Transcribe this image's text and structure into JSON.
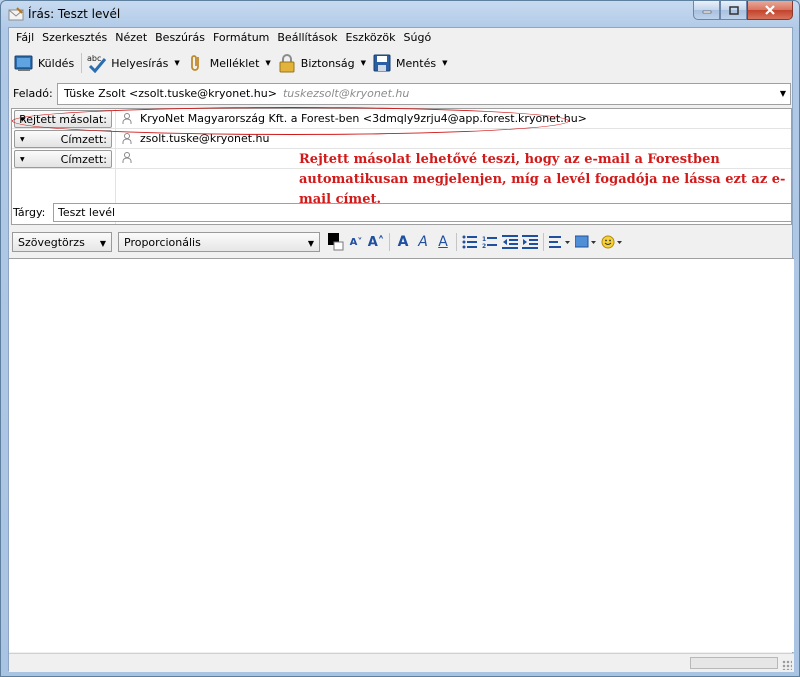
{
  "window": {
    "title": "Írás: Teszt levél"
  },
  "menu": [
    {
      "label": "Fájl"
    },
    {
      "label": "Szerkesztés"
    },
    {
      "label": "Nézet"
    },
    {
      "label": "Beszúrás"
    },
    {
      "label": "Formátum"
    },
    {
      "label": "Beállítások"
    },
    {
      "label": "Eszközök"
    },
    {
      "label": "Súgó"
    }
  ],
  "toolbar": {
    "send_label": "Küldés",
    "spell_label": "Helyesírás",
    "attach_label": "Melléklet",
    "security_label": "Biztonság",
    "save_label": "Mentés"
  },
  "header": {
    "from_label": "Feladó:",
    "from_value": "Tüske Zsolt <zsolt.tuske@kryonet.hu>",
    "from_alias": "tuskezsolt@kryonet.hu",
    "recipients": [
      {
        "type": "Rejtett másolat:",
        "address": "KryoNet Magyarország Kft. a Forest-ben <3dmqly9zrju4@app.forest.kryonet.hu>"
      },
      {
        "type": "Címzett:",
        "address": "zsolt.tuske@kryonet.hu"
      },
      {
        "type": "Címzett:",
        "address": ""
      }
    ],
    "subject_label": "Tárgy:",
    "subject_value": "Teszt levél"
  },
  "annotation": {
    "text": "Rejtett másolat lehetővé teszi, hogy az e-mail a Forestben automatikusan megjelenjen, míg a levél fogadója ne lássa ezt az e-mail címet."
  },
  "format": {
    "paragraph_style": "Szövegtörzs",
    "font": "Proporcionális"
  },
  "colors": {
    "annotation": "#d21a1a",
    "accent": "#1f4f9f"
  }
}
